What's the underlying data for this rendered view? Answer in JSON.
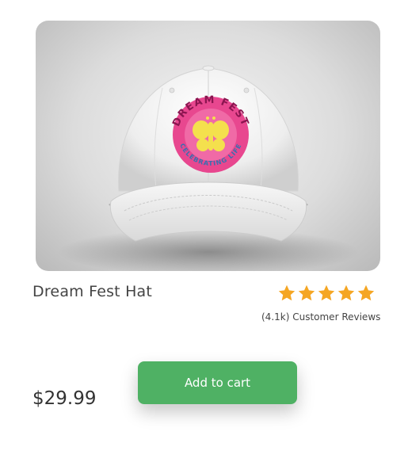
{
  "product": {
    "name": "Dream Fest Hat",
    "price": "$29.99",
    "rating": 5,
    "rating_max": 5,
    "reviews_text": "(4.1k) Customer Reviews",
    "image": {
      "logo_text_top": "DREAM FEST",
      "logo_text_bottom": "CELEBRATING LIFE"
    }
  },
  "actions": {
    "add_to_cart_label": "Add to cart"
  },
  "colors": {
    "accent_green": "#4fb164",
    "star_orange": "#f5a623",
    "logo_pink": "#e8478f",
    "logo_yellow": "#f4e04d"
  },
  "icons": {
    "star": "star-icon"
  }
}
